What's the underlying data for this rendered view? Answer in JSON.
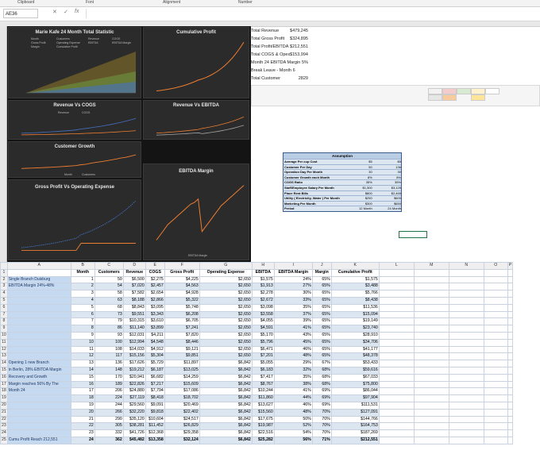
{
  "ribbon": {
    "groups": [
      "Clipboard",
      "Font",
      "Alignment",
      "Number"
    ]
  },
  "formula_bar": {
    "name_box": "AE36",
    "fx_label": "fx"
  },
  "dashboard": {
    "panels": {
      "main": {
        "title": "Marie Kafe 24 Month Total Statistic",
        "legend": [
          "Month",
          "Customers",
          "Revenue",
          "COGS",
          "Gross Profit",
          "Operating Expense",
          "EBITDA",
          "EBITDA Margin",
          "Margin",
          "Cumulative Profit"
        ]
      },
      "cumulative": {
        "title": "Cumulative Profit"
      },
      "rev_cogs": {
        "title": "Revenue Vs COGS",
        "legend": [
          "Revenue",
          "COGS"
        ]
      },
      "rev_ebitda": {
        "title": "Revenue Vs EBITDA"
      },
      "customer": {
        "title": "Customer Growth",
        "legend": [
          "Month",
          "Customers"
        ]
      },
      "ebitda_margin": {
        "title": "EBITDA Margin",
        "legend": [
          "EBITDA Margin"
        ]
      },
      "gp_opex": {
        "title": "Gross Profit Vs Operating Expense"
      }
    }
  },
  "kpis": [
    {
      "label": "Total Revenue",
      "value": "$479,245"
    },
    {
      "label": "Total Gross Profit",
      "value": "$324,895"
    },
    {
      "label": "Total Profit/EBITDA",
      "value": "$212,551"
    },
    {
      "label": "Total COGS & Opex",
      "value": "$153,994"
    },
    {
      "label": "Month 24 EBITDA Margin",
      "value": "5%"
    },
    {
      "label": "Break Leave - Month 6",
      "value": ""
    },
    {
      "label": "Total Customer",
      "value": "2829"
    }
  ],
  "assumptions": {
    "title": "Assumption",
    "rows": [
      [
        "Average Per cup Cost",
        "$5",
        "$5"
      ],
      [
        "Customer Per Day",
        "50",
        "136"
      ],
      [
        "Operation Day Per Month",
        "30",
        "30"
      ],
      [
        "Customer Growth each Month",
        "8%",
        "8%"
      ],
      [
        "COGS Ratio",
        "35%",
        "35%"
      ],
      [
        "Staff/Employee Salary Per Month",
        "$1,300",
        "$3,125"
      ],
      [
        "Place Rent Bills",
        "$800",
        "$2,465"
      ],
      [
        "Utility ( Electricity, Water ) Per Month",
        "$250",
        "$600"
      ],
      [
        "Marketing Per Month",
        "$300",
        "$650"
      ],
      [
        "Period",
        "12 Month",
        "24 Month"
      ]
    ]
  },
  "sheet": {
    "col_letters": [
      "A",
      "B",
      "C",
      "D",
      "E",
      "F",
      "G",
      "H",
      "I",
      "J",
      "K",
      "L",
      "M",
      "N",
      "O",
      "P"
    ],
    "headers": [
      "Month",
      "Customers",
      "Revenue",
      "COGS",
      "Gross Profit",
      "Operating Expense",
      "EBITDA",
      "EBITDA Margin",
      "Margin",
      "Cumulative Profit"
    ],
    "notes": [
      "Single Branch Duisburg",
      "EBITDA Margin 24%-48%",
      "Opening 1 new Branch",
      "in Berlin, 28% EBITDA Margin",
      "Recovery and Growth",
      "Margin reaches 56% By The",
      "Month 24",
      "Cumu Profit Reach 212,551"
    ],
    "rows": [
      [
        "1",
        "50",
        "$6,500",
        "$2,275",
        "$4,225",
        "$2,650",
        "$1,575",
        "24%",
        "65%",
        "$1,575"
      ],
      [
        "2",
        "54",
        "$7,020",
        "$2,457",
        "$4,563",
        "$2,650",
        "$1,913",
        "27%",
        "65%",
        "$3,488"
      ],
      [
        "3",
        "58",
        "$7,582",
        "$2,654",
        "$4,928",
        "$2,650",
        "$2,278",
        "30%",
        "65%",
        "$5,766"
      ],
      [
        "4",
        "63",
        "$8,188",
        "$2,866",
        "$5,322",
        "$2,650",
        "$2,672",
        "33%",
        "65%",
        "$8,438"
      ],
      [
        "5",
        "68",
        "$8,843",
        "$3,095",
        "$5,748",
        "$2,650",
        "$3,098",
        "35%",
        "65%",
        "$11,536"
      ],
      [
        "6",
        "73",
        "$9,551",
        "$3,343",
        "$6,208",
        "$2,650",
        "$3,558",
        "37%",
        "65%",
        "$15,094"
      ],
      [
        "7",
        "79",
        "$10,315",
        "$3,610",
        "$6,705",
        "$2,650",
        "$4,055",
        "39%",
        "65%",
        "$19,149"
      ],
      [
        "8",
        "86",
        "$11,140",
        "$3,899",
        "$7,241",
        "$2,650",
        "$4,591",
        "41%",
        "65%",
        "$23,740"
      ],
      [
        "9",
        "93",
        "$12,031",
        "$4,211",
        "$7,820",
        "$2,650",
        "$5,170",
        "43%",
        "65%",
        "$28,910"
      ],
      [
        "10",
        "100",
        "$12,994",
        "$4,548",
        "$8,446",
        "$2,650",
        "$5,796",
        "45%",
        "65%",
        "$34,706"
      ],
      [
        "11",
        "108",
        "$14,033",
        "$4,912",
        "$9,121",
        "$2,650",
        "$6,471",
        "46%",
        "65%",
        "$41,177"
      ],
      [
        "12",
        "117",
        "$15,156",
        "$5,304",
        "$9,851",
        "$2,650",
        "$7,201",
        "48%",
        "65%",
        "$48,378"
      ],
      [
        "13",
        "136",
        "$17,626",
        "$5,729",
        "$11,897",
        "$6,842",
        "$5,055",
        "29%",
        "67%",
        "$53,433"
      ],
      [
        "14",
        "148",
        "$19,212",
        "$6,187",
        "$13,025",
        "$6,842",
        "$6,183",
        "32%",
        "68%",
        "$59,616"
      ],
      [
        "15",
        "170",
        "$20,941",
        "$6,682",
        "$14,259",
        "$6,842",
        "$7,417",
        "35%",
        "68%",
        "$67,033"
      ],
      [
        "16",
        "189",
        "$22,826",
        "$7,217",
        "$15,609",
        "$6,842",
        "$8,767",
        "38%",
        "68%",
        "$75,800"
      ],
      [
        "17",
        "206",
        "$24,880",
        "$7,794",
        "$17,086",
        "$6,842",
        "$10,244",
        "41%",
        "69%",
        "$86,044"
      ],
      [
        "18",
        "224",
        "$27,119",
        "$8,418",
        "$18,702",
        "$6,842",
        "$11,860",
        "44%",
        "69%",
        "$97,904"
      ],
      [
        "19",
        "244",
        "$29,560",
        "$9,091",
        "$20,469",
        "$6,842",
        "$13,627",
        "46%",
        "69%",
        "$111,531"
      ],
      [
        "20",
        "266",
        "$32,220",
        "$9,818",
        "$22,402",
        "$6,842",
        "$15,560",
        "48%",
        "70%",
        "$127,091"
      ],
      [
        "21",
        "290",
        "$35,120",
        "$10,604",
        "$24,517",
        "$6,842",
        "$17,675",
        "50%",
        "70%",
        "$144,766"
      ],
      [
        "22",
        "305",
        "$38,281",
        "$11,452",
        "$26,829",
        "$6,842",
        "$19,987",
        "52%",
        "70%",
        "$164,753"
      ],
      [
        "23",
        "332",
        "$41,726",
        "$12,368",
        "$29,358",
        "$6,842",
        "$22,516",
        "54%",
        "70%",
        "$187,269"
      ],
      [
        "24",
        "362",
        "$45,482",
        "$13,358",
        "$32,124",
        "$6,842",
        "$25,282",
        "56%",
        "71%",
        "$212,551"
      ]
    ]
  },
  "colors": {
    "dash_bg": "#141414",
    "panel_bg": "#2b2b2b",
    "orange": "#ed7d31",
    "blue": "#4472c4",
    "table_band": "#dce6f1",
    "note_fill": "#c5d9f1"
  }
}
